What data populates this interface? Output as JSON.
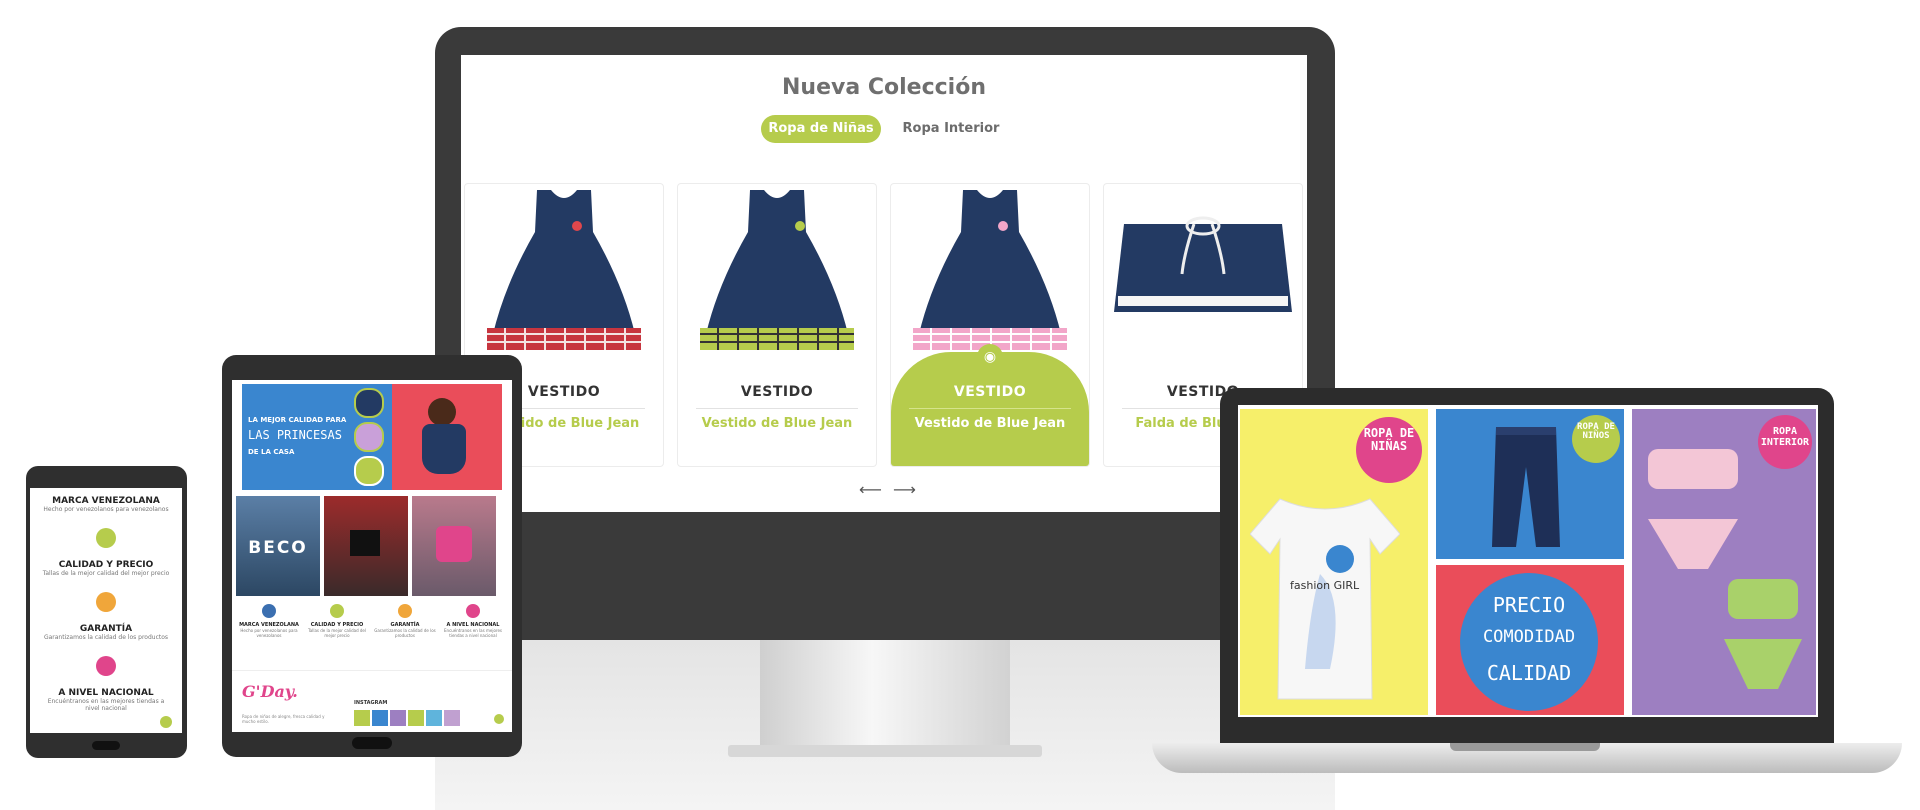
{
  "desktop": {
    "section_title": "Nueva Colección",
    "tabs": [
      {
        "label": "Ropa de Niñas",
        "active": true
      },
      {
        "label": "Ropa Interior",
        "active": false
      }
    ],
    "products": [
      {
        "type": "VESTIDO",
        "name": "Vestido de Blue Jean",
        "trim": "red-plaid",
        "bow": "#e0474c"
      },
      {
        "type": "VESTIDO",
        "name": "Vestido de Blue Jean",
        "trim": "green-plaid",
        "bow": "#b6cc4c"
      },
      {
        "type": "VESTIDO",
        "name": "Vestido de Blue Jean",
        "trim": "pink-plaid",
        "bow": "#f2a6c9",
        "highlighted": true
      },
      {
        "type": "VESTIDO",
        "name": "Falda de Blue Jean",
        "trim": "skirt"
      }
    ],
    "prev_icon": "arrow-left-icon",
    "next_icon": "arrow-right-icon",
    "accent": "#b6cc4c"
  },
  "tablet": {
    "banner": {
      "line1": "LA MEJOR CALIDAD PARA",
      "line2": "LAS PRINCESAS",
      "line3": "DE LA CASA"
    },
    "stores": [
      "BECO",
      "",
      ""
    ],
    "features": [
      {
        "title": "MARCA VENEZOLANA",
        "desc": "Hecho por venezolanos para venezolanos"
      },
      {
        "title": "CALIDAD Y PRECIO",
        "desc": "Tallas de la mejor calidad del mejor precio"
      },
      {
        "title": "GARANTÍA",
        "desc": "Garantizamos la calidad de los productos"
      },
      {
        "title": "A NIVEL NACIONAL",
        "desc": "Encuéntranos en las mejores tiendas a nivel nacional"
      }
    ],
    "footer_logo": "G'Day.",
    "footer_text": "Ropa de niñas de alegre, fresca calidad y mucho estilo.",
    "instagram_label": "INSTAGRAM"
  },
  "phone": {
    "features": [
      {
        "title": "MARCA VENEZOLANA",
        "desc": "Hecho por venezolanos para venezolanos",
        "color": "#3b6fb0"
      },
      {
        "title": "CALIDAD Y PRECIO",
        "desc": "Tallas de la mejor calidad del mejor precio",
        "color": "#b6cc4c"
      },
      {
        "title": "GARANTÍA",
        "desc": "Garantizamos la calidad de los productos",
        "color": "#f0a63a"
      },
      {
        "title": "A NIVEL NACIONAL",
        "desc": "Encuéntranos en las mejores tiendas a nivel nacional",
        "color": "#e0458b"
      }
    ]
  },
  "laptop": {
    "tile1_badge": "ROPA DE NIÑAS",
    "tile2_badge": "ROPA DE NIÑOS",
    "tile3_badge": "ROPA INTERIOR",
    "tile4_lines": [
      "PRECIO",
      "COMODIDAD",
      "CALIDAD"
    ],
    "tee_text": "fashion GIRL",
    "colors": {
      "yellow": "#f6ef6a",
      "blue": "#3a86cf",
      "purple": "#9d7fc1",
      "coral": "#ea4d5a",
      "magenta": "#e0458b"
    }
  }
}
